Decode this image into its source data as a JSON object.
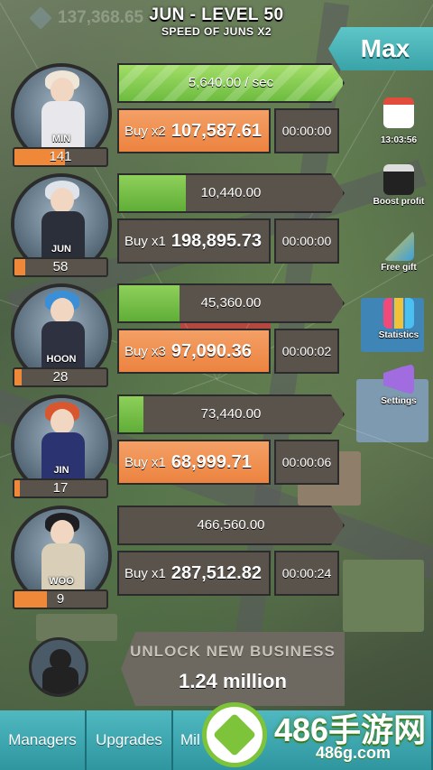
{
  "header": {
    "money": "137,368.65",
    "title": "JUN - LEVEL 50",
    "subtitle": "SPEED OF JUNS X2",
    "max_label": "Max"
  },
  "businesses": [
    {
      "name": "MIN",
      "level": "141",
      "level_fraction": 0.55,
      "rate": "5,640.00 / sec",
      "progress_fraction": 1.0,
      "buy_mult": "Buy x2",
      "cost": "107,587.61",
      "timer": "00:00:00",
      "buy_active": true,
      "hair": "#f0e6d8",
      "outfit": "#e8e8ec"
    },
    {
      "name": "JUN",
      "level": "58",
      "level_fraction": 0.12,
      "rate": "10,440.00",
      "progress_fraction": 0.3,
      "buy_mult": "Buy x1",
      "cost": "198,895.73",
      "timer": "00:00:00",
      "buy_active": false,
      "hair": "#dfe3ea",
      "outfit": "#2b2f3a"
    },
    {
      "name": "HOON",
      "level": "28",
      "level_fraction": 0.08,
      "rate": "45,360.00",
      "progress_fraction": 0.27,
      "buy_mult": "Buy x3",
      "cost": "97,090.36",
      "timer": "00:00:02",
      "buy_active": true,
      "hair": "#3a8fd6",
      "outfit": "#2e3140"
    },
    {
      "name": "JIN",
      "level": "17",
      "level_fraction": 0.06,
      "rate": "73,440.00",
      "progress_fraction": 0.11,
      "buy_mult": "Buy x1",
      "cost": "68,999.71",
      "timer": "00:00:06",
      "buy_active": true,
      "hair": "#d8572e",
      "outfit": "#2b3470"
    },
    {
      "name": "WOO",
      "level": "9",
      "level_fraction": 0.35,
      "rate": "466,560.00",
      "progress_fraction": 0.0,
      "buy_mult": "Buy x1",
      "cost": "287,512.82",
      "timer": "00:00:24",
      "buy_active": false,
      "hair": "#1e1e22",
      "outfit": "#d9cfb8"
    }
  ],
  "side_menu": {
    "clock": "13:03:56",
    "boost": "Boost profit",
    "gift": "Free gift",
    "stats": "Statistics",
    "settings": "Settings"
  },
  "unlock": {
    "title": "UNLOCK NEW BUSINESS",
    "price": "1.24 million"
  },
  "tabs": [
    "Managers",
    "Upgrades",
    "Mil"
  ],
  "watermark": {
    "main": "486手游网",
    "sub": "486g.com"
  },
  "colors": {
    "accent_teal": "#4fb8c0",
    "buy_orange": "#ec8340",
    "progress_green": "#6dbc3f"
  }
}
